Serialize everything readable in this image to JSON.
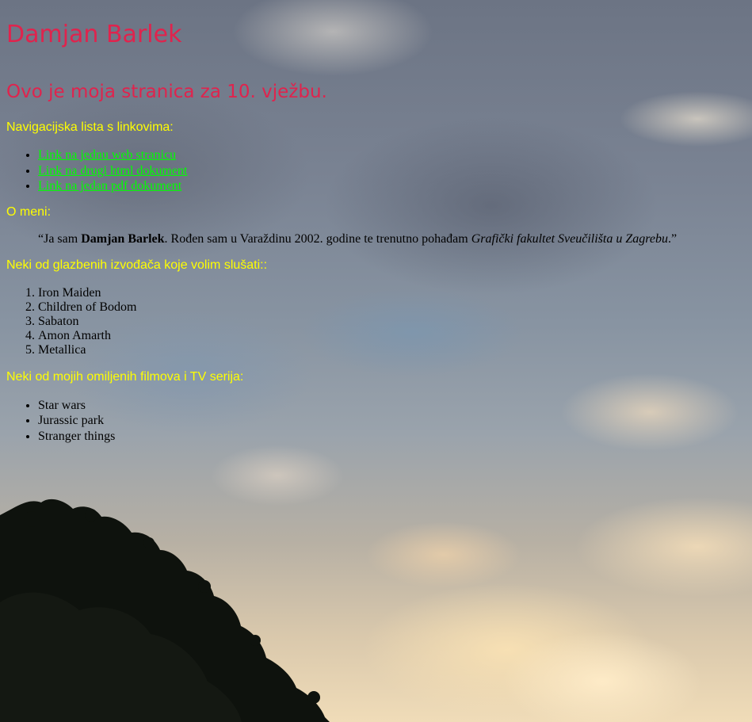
{
  "header": {
    "name": "Damjan Barlek",
    "subtitle": "Ovo je moja stranica za 10. vježbu."
  },
  "navigation": {
    "heading": "Navigacijska lista s linkovima:",
    "links": [
      {
        "label": "Link na jednu web stranicu"
      },
      {
        "label": "Link na drugi html dokument"
      },
      {
        "label": "Link na jedan pdf dokument"
      }
    ]
  },
  "about": {
    "heading": "O meni:",
    "open_quote": "“Ja sam ",
    "bold_name": "Damjan Barlek",
    "middle_text": ". Rođen sam u Varaždinu 2002. godine te trenutno pohađam ",
    "italic_school": "Grafički fakultet Sveučilišta u Zagrebu",
    "close_quote": ".”"
  },
  "music": {
    "heading": "Neki od glazbenih izvođača koje volim slušati::",
    "items": [
      "Iron Maiden",
      "Children of Bodom",
      "Sabaton",
      "Amon Amarth",
      "Metallica"
    ]
  },
  "movies": {
    "heading": "Neki od mojih omiljenih filmova i TV serija:",
    "items": [
      "Star wars",
      "Jurassic park",
      "Stranger things"
    ]
  },
  "colors": {
    "heading_accent": "#e0234d",
    "section_heading": "#ffff00",
    "link": "#00ff00"
  }
}
